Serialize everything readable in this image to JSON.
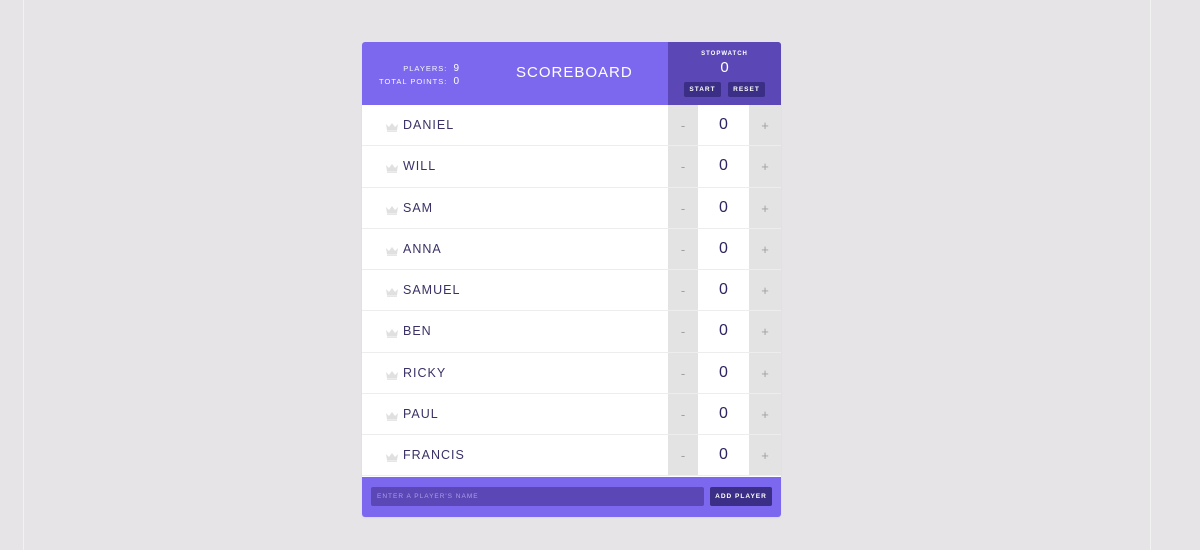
{
  "header": {
    "title": "SCOREBOARD",
    "players_label": "PLAYERS:",
    "players_value": "9",
    "total_points_label": "TOTAL POINTS:",
    "total_points_value": "0"
  },
  "stopwatch": {
    "label": "STOPWATCH",
    "time": "0",
    "start_label": "START",
    "reset_label": "RESET"
  },
  "players": [
    {
      "name": "DANIEL",
      "score": "0"
    },
    {
      "name": "WILL",
      "score": "0"
    },
    {
      "name": "SAM",
      "score": "0"
    },
    {
      "name": "ANNA",
      "score": "0"
    },
    {
      "name": "SAMUEL",
      "score": "0"
    },
    {
      "name": "BEN",
      "score": "0"
    },
    {
      "name": "RICKY",
      "score": "0"
    },
    {
      "name": "PAUL",
      "score": "0"
    },
    {
      "name": "FRANCIS",
      "score": "0"
    }
  ],
  "controls": {
    "decrement_label": "-",
    "increment_label": "+"
  },
  "icons": {
    "player_icon": "crown-icon"
  },
  "add_form": {
    "placeholder": "ENTER A PLAYER'S NAME",
    "button_label": "ADD PLAYER"
  },
  "colors": {
    "accent": "#7b68ee",
    "accent_dark": "#5b48b6",
    "button_dark": "#3b2e86",
    "page_background": "#e6e4e6",
    "counter_button": "#e3e3e3",
    "text_dark": "#3a3166"
  }
}
